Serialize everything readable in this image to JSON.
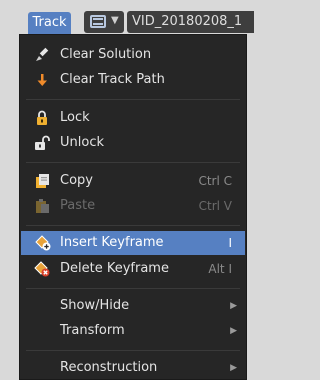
{
  "header": {
    "menu_label": "Track",
    "clip_name": "VID_20180208_1"
  },
  "menu": {
    "items": [
      {
        "label": "Clear Solution",
        "icon": "brush-icon"
      },
      {
        "label": "Clear Track Path",
        "icon": "arrow-down-icon"
      },
      {
        "label": "Lock",
        "icon": "lock-icon"
      },
      {
        "label": "Unlock",
        "icon": "unlock-icon"
      },
      {
        "label": "Copy",
        "icon": "copy-icon",
        "shortcut": "Ctrl C"
      },
      {
        "label": "Paste",
        "icon": "paste-icon",
        "shortcut": "Ctrl V",
        "disabled": true
      },
      {
        "label": "Insert Keyframe",
        "icon": "keyframe-insert-icon",
        "shortcut": "I",
        "highlighted": true
      },
      {
        "label": "Delete Keyframe",
        "icon": "keyframe-delete-icon",
        "shortcut": "Alt I"
      },
      {
        "label": "Show/Hide",
        "submenu": true
      },
      {
        "label": "Transform",
        "submenu": true
      },
      {
        "label": "Reconstruction",
        "submenu": true
      }
    ]
  },
  "colors": {
    "highlight": "#5680c2",
    "menu_bg": "#262626",
    "keyframe_orange": "#e8a33a",
    "delete_red": "#d9422b"
  }
}
